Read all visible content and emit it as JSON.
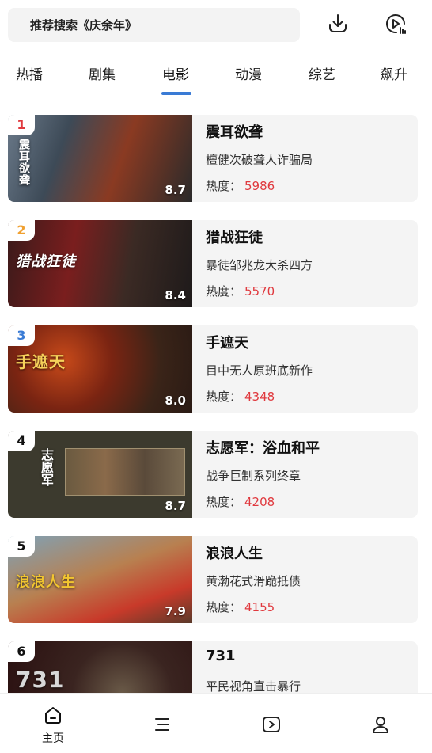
{
  "search": {
    "text": "推荐搜索《庆余年》"
  },
  "tabs": [
    {
      "label": "热播"
    },
    {
      "label": "剧集"
    },
    {
      "label": "电影"
    },
    {
      "label": "动漫"
    },
    {
      "label": "综艺"
    },
    {
      "label": "飙升"
    }
  ],
  "active_tab": "电影",
  "heat_label": "热度：",
  "items": [
    {
      "rank": "1",
      "rank_color": "#e0393e",
      "title": "震耳欲聋",
      "desc": "檀健次破聋人诈骗局",
      "heat": "5986",
      "score": "8.7",
      "poster_text": "震耳欲聋"
    },
    {
      "rank": "2",
      "rank_color": "#f0a030",
      "title": "猎战狂徒",
      "desc": "暴徒邹兆龙大杀四方",
      "heat": "5570",
      "score": "8.4",
      "poster_text": "猎战狂徒"
    },
    {
      "rank": "3",
      "rank_color": "#3a7bd5",
      "title": "手遮天",
      "desc": "目中无人原班底新作",
      "heat": "4348",
      "score": "8.0",
      "poster_text": "手遮天"
    },
    {
      "rank": "4",
      "rank_color": "#111111",
      "title": "志愿军：浴血和平",
      "desc": "战争巨制系列终章",
      "heat": "4208",
      "score": "8.7",
      "poster_text": "志愿军"
    },
    {
      "rank": "5",
      "rank_color": "#111111",
      "title": "浪浪人生",
      "desc": "黄渤花式滑跪抵债",
      "heat": "4155",
      "score": "7.9",
      "poster_text": "浪浪人生"
    },
    {
      "rank": "6",
      "rank_color": "#111111",
      "title": "731",
      "desc": "平民视角直击暴行",
      "heat": "",
      "score": "",
      "poster_text": "731"
    }
  ],
  "nav": {
    "home_label": "主页"
  },
  "colors": {
    "accent": "#3a7bd5",
    "heat": "#e0393e"
  }
}
